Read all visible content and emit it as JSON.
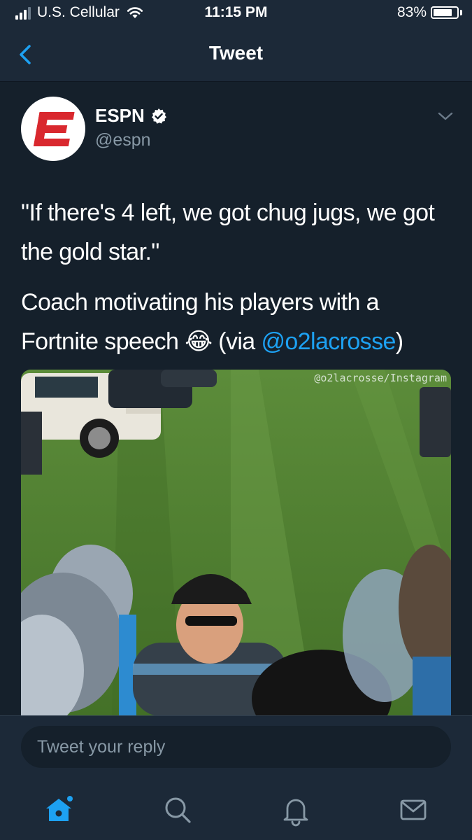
{
  "status_bar": {
    "carrier": "U.S. Cellular",
    "time": "11:15 PM",
    "battery_percent": "83%",
    "battery_level": 0.83,
    "signal_bars": 3
  },
  "nav": {
    "title": "Tweet",
    "back_icon": "chevron-left-icon"
  },
  "tweet": {
    "author_name": "ESPN",
    "author_handle": "@espn",
    "verified": true,
    "text_quote": "\"If there's 4 left, we got chug jugs, we got the gold star.\"",
    "text_body": "Coach motivating his players with a Fortnite speech",
    "emoji": "😂",
    "via_prefix": "(via ",
    "via_mention": "@o2lacrosse",
    "via_suffix": ")",
    "media_watermark": "@o2lacrosse/Instagram"
  },
  "reply": {
    "placeholder": "Tweet your reply"
  },
  "tabs": [
    {
      "name": "home",
      "icon": "home-icon",
      "active": true
    },
    {
      "name": "search",
      "icon": "search-icon",
      "active": false
    },
    {
      "name": "notifications",
      "icon": "bell-icon",
      "active": false
    },
    {
      "name": "messages",
      "icon": "envelope-icon",
      "active": false
    }
  ],
  "colors": {
    "background": "#15202b",
    "bar": "#1c2938",
    "accent": "#1da1f2",
    "muted": "#8899a6",
    "espn_red": "#d9282e"
  }
}
